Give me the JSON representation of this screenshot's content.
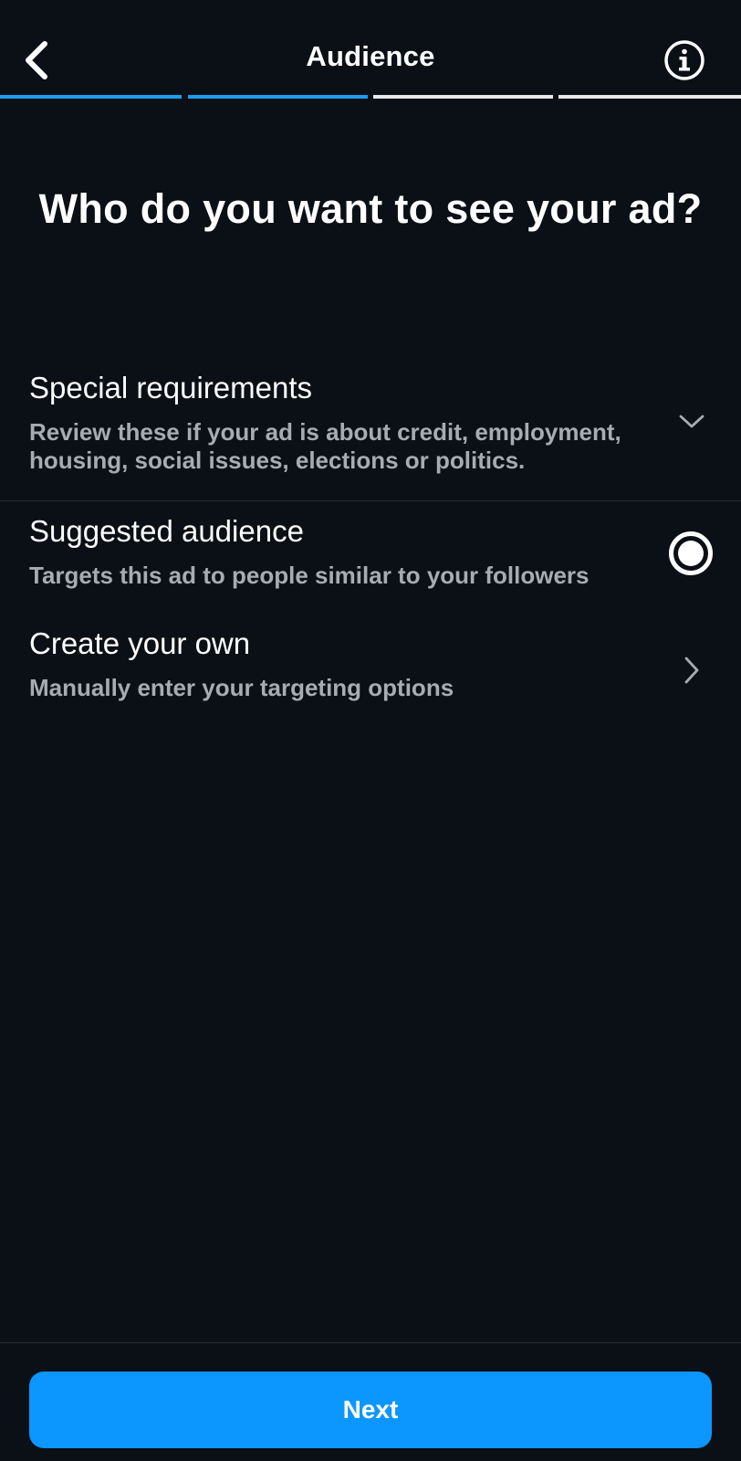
{
  "colors": {
    "background": "#0b1016",
    "accent": "#0c96ff",
    "progress_active": "#1d9bf0",
    "progress_inactive": "#e7e9ea",
    "secondary_text": "#a5acb4",
    "divider": "#262c33"
  },
  "header": {
    "title": "Audience",
    "back_icon": "chevron-left-icon",
    "info_icon": "info-circle-icon"
  },
  "progress": {
    "total_steps": 4,
    "completed_steps": 2
  },
  "headline": "Who do you want to see your ad?",
  "options": {
    "special_requirements": {
      "title": "Special requirements",
      "subtitle": "Review these if your ad is about credit, employment, housing, social issues, elections or politics.",
      "icon": "chevron-down-icon"
    },
    "suggested_audience": {
      "title": "Suggested audience",
      "subtitle": "Targets this ad to people similar to your followers",
      "selected": true,
      "icon": "radio-selected-icon"
    },
    "create_your_own": {
      "title": "Create your own",
      "subtitle": "Manually enter your targeting options",
      "icon": "chevron-right-icon"
    }
  },
  "footer": {
    "next_label": "Next"
  }
}
